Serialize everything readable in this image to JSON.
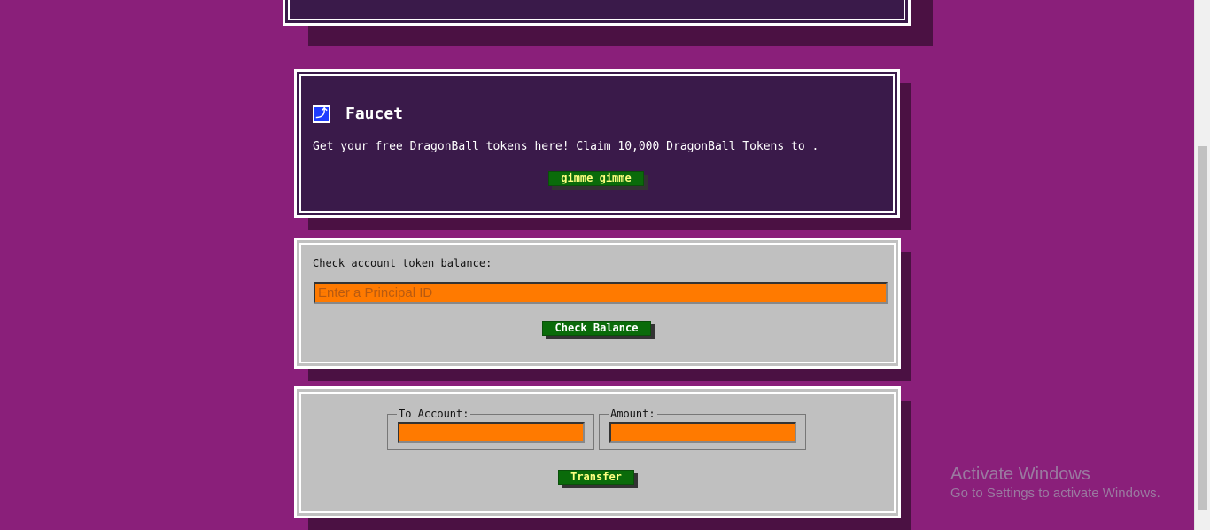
{
  "faucet": {
    "title": "Faucet",
    "icon": "faucet-icon",
    "description": "Get your free DragonBall tokens here! Claim 10,000 DragonBall Tokens to .",
    "button_label": "gimme gimme"
  },
  "balance": {
    "label": "Check account token balance:",
    "input_placeholder": "Enter a Principal ID",
    "button_label": "Check Balance"
  },
  "transfer": {
    "to_account_legend": "To Account:",
    "amount_legend": "Amount:",
    "button_label": "Transfer"
  },
  "watermark": {
    "line1": "Activate Windows",
    "line2": "Go to Settings to activate Windows."
  },
  "colors": {
    "background": "#8a1f7a",
    "dark_panel": "#3a1a4a",
    "light_panel": "#c0c0c0",
    "input": "#ff7a00",
    "button": "#0a6b0a"
  }
}
